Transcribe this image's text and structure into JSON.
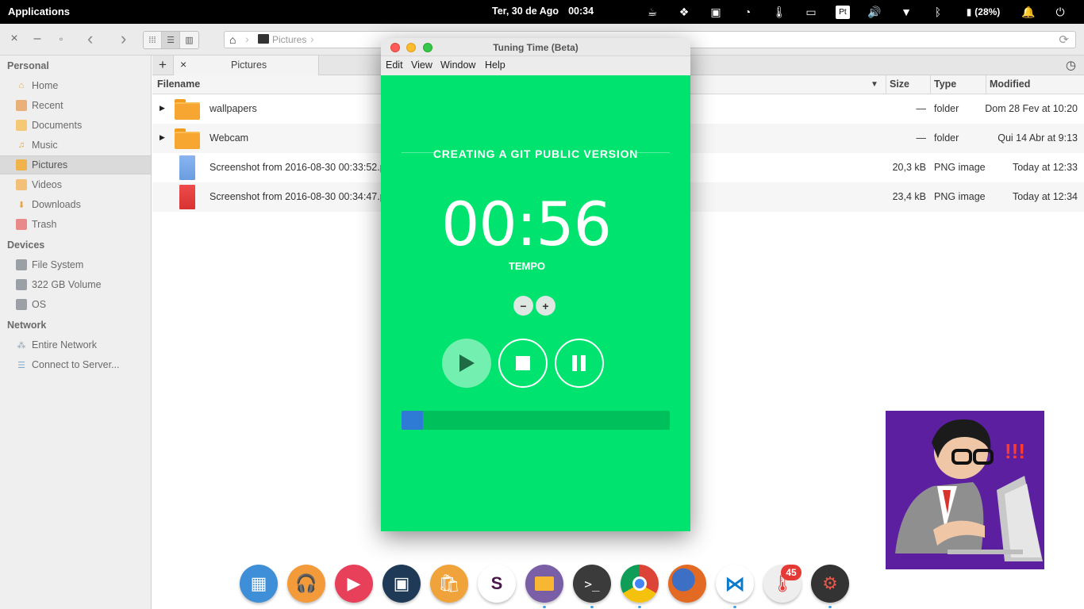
{
  "topbar": {
    "applications": "Applications",
    "date": "Ter, 30 de Ago",
    "time": "00:34",
    "keyboard_layout": "Pt",
    "battery": "(28%)",
    "icons": [
      "coffee-icon",
      "dropbox-icon",
      "cpu-icon",
      "wifi-hotspot-icon",
      "thermometer-icon",
      "screenshot-icon",
      "keyboard-layout",
      "volume-icon",
      "wifi-icon",
      "bluetooth-icon",
      "battery-icon",
      "notifications-icon",
      "power-icon"
    ]
  },
  "filemanager": {
    "path": {
      "current": "Pictures"
    },
    "tabs": [
      {
        "label": "Pictures"
      }
    ],
    "sidebar": {
      "sections": [
        {
          "title": "Personal",
          "items": [
            {
              "label": "Home",
              "icon": "home-icon"
            },
            {
              "label": "Recent",
              "icon": "recent-icon"
            },
            {
              "label": "Documents",
              "icon": "documents-icon"
            },
            {
              "label": "Music",
              "icon": "music-icon"
            },
            {
              "label": "Pictures",
              "icon": "pictures-icon",
              "selected": true
            },
            {
              "label": "Videos",
              "icon": "videos-icon"
            },
            {
              "label": "Downloads",
              "icon": "downloads-icon"
            },
            {
              "label": "Trash",
              "icon": "trash-icon"
            }
          ]
        },
        {
          "title": "Devices",
          "items": [
            {
              "label": "File System",
              "icon": "drive-icon"
            },
            {
              "label": "322 GB Volume",
              "icon": "drive-icon"
            },
            {
              "label": "OS",
              "icon": "drive-icon"
            }
          ]
        },
        {
          "title": "Network",
          "items": [
            {
              "label": "Entire Network",
              "icon": "network-icon"
            },
            {
              "label": "Connect to Server...",
              "icon": "server-icon"
            }
          ]
        }
      ]
    },
    "columns": {
      "filename": "Filename",
      "size": "Size",
      "type": "Type",
      "modified": "Modified"
    },
    "files": [
      {
        "name": "wallpapers",
        "size": "—",
        "type": "folder",
        "modified": "Dom 28 Fev at 10:20",
        "kind": "folder"
      },
      {
        "name": "Webcam",
        "size": "—",
        "type": "folder",
        "modified": "Qui 14 Abr at 9:13",
        "kind": "folder"
      },
      {
        "name": "Screenshot from 2016-08-30 00:33:52.p",
        "size": "20,3 kB",
        "type": "PNG image",
        "modified": "Today at 12:33",
        "kind": "image-blue"
      },
      {
        "name": "Screenshot from 2016-08-30 00:34:47.p",
        "size": "23,4 kB",
        "type": "PNG image",
        "modified": "Today at 12:34",
        "kind": "image-red"
      }
    ]
  },
  "tuning_time": {
    "title": "Tuning Time (Beta)",
    "menu": [
      "Edit",
      "View",
      "Window",
      "Help"
    ],
    "task": "CREATING A GIT PUBLIC VERSION",
    "timer": "00:56",
    "timer_label": "TEMPO",
    "decrease": "−",
    "increase": "+",
    "progress": 0.08,
    "colors": {
      "background": "#00e36e",
      "progress_fill": "#2e7bd6",
      "progress_track": "#00c05c"
    }
  },
  "dock": {
    "apps": [
      {
        "name": "multitasking-view",
        "color": "#3f8fd8"
      },
      {
        "name": "music-player",
        "color": "#f39a3b"
      },
      {
        "name": "video-player",
        "color": "#e8405a"
      },
      {
        "name": "photos",
        "color": "#1f3a56"
      },
      {
        "name": "app-center",
        "color": "#f0a33a"
      },
      {
        "name": "slack",
        "color": "#ffffff"
      },
      {
        "name": "files",
        "color": "#7b5fa6"
      },
      {
        "name": "terminal",
        "color": "#3b3b3b"
      },
      {
        "name": "chrome",
        "color": "#e8e8e8"
      },
      {
        "name": "firefox",
        "color": "#e36a23"
      },
      {
        "name": "visual-studio-code",
        "color": "#ffffff"
      },
      {
        "name": "system-monitor",
        "color": "#eeeeee",
        "badge": "45"
      },
      {
        "name": "settings",
        "color": "#333333"
      }
    ]
  }
}
